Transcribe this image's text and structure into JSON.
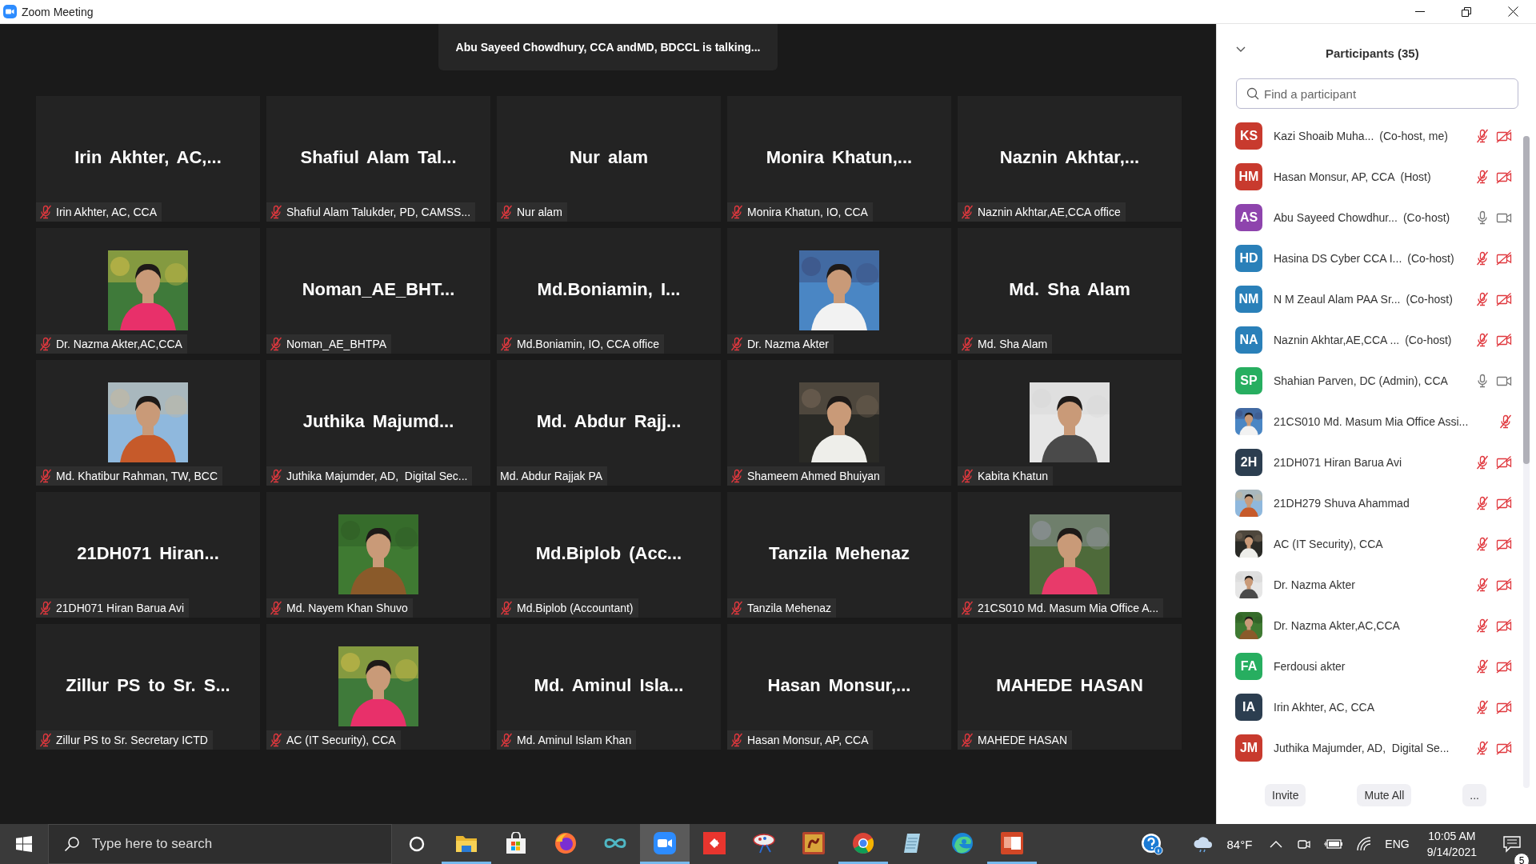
{
  "window": {
    "title": "Zoom Meeting"
  },
  "speaker_banner": "Abu Sayeed Chowdhury, CCA andMD, BDCCL is talking...",
  "tiles": [
    {
      "kind": "name",
      "display": "Irin Akhter, AC,...",
      "label": "Irin Akhter, AC, CCA",
      "muted": true
    },
    {
      "kind": "name",
      "display": "Shafiul Alam Tal...",
      "label": "Shafiul Alam Talukder, PD, CAMSS...",
      "muted": true
    },
    {
      "kind": "name",
      "display": "Nur alam",
      "label": "Nur alam",
      "muted": true
    },
    {
      "kind": "name",
      "display": "Monira Khatun,...",
      "label": "Monira Khatun, IO, CCA",
      "muted": true
    },
    {
      "kind": "name",
      "display": "Naznin Akhtar,...",
      "label": "Naznin Akhtar,AE,CCA office",
      "muted": true
    },
    {
      "label": "Dr. Nazma Akter,AC,CCA",
      "muted": true
    },
    {
      "kind": "name",
      "display": "Noman_AE_BHT...",
      "label": "Noman_AE_BHTPA",
      "muted": true
    },
    {
      "kind": "name",
      "display": "Md.Boniamin, I...",
      "label": "Md.Boniamin, IO, CCA office",
      "muted": true
    },
    {
      "label": "Dr. Nazma Akter",
      "muted": true
    },
    {
      "kind": "name",
      "display": "Md. Sha Alam",
      "label": "Md. Sha Alam",
      "muted": true
    },
    {
      "label": "Md. Khatibur Rahman, TW, BCC",
      "muted": true
    },
    {
      "kind": "name",
      "display": "Juthika Majumd...",
      "label": "Juthika Majumder, AD,  Digital Sec...",
      "muted": true
    },
    {
      "kind": "name",
      "display": "Md. Abdur Rajj...",
      "label": "Md. Abdur Rajjak PA",
      "muted": false
    },
    {
      "label": "Shameem Ahmed Bhuiyan",
      "muted": true
    },
    {
      "label": "Kabita Khatun",
      "muted": true
    },
    {
      "kind": "name",
      "display": "21DH071 Hiran...",
      "label": "21DH071 Hiran Barua Avi",
      "muted": true
    },
    {
      "label": "Md. Nayem Khan Shuvo",
      "muted": true
    },
    {
      "kind": "name",
      "display": "Md.Biplob (Acc...",
      "label": "Md.Biplob (Accountant)",
      "muted": true
    },
    {
      "kind": "name",
      "display": "Tanzila Mehenaz",
      "label": "Tanzila Mehenaz",
      "muted": true
    },
    {
      "label": "21CS010 Md. Masum Mia Office A...",
      "muted": true
    },
    {
      "kind": "name",
      "display": "Zillur PS to Sr. S...",
      "label": "Zillur PS to Sr. Secretary ICTD",
      "muted": true
    },
    {
      "label": "AC (IT Security), CCA",
      "muted": true
    },
    {
      "kind": "name",
      "display": "Md. Aminul Isla...",
      "label": "Md. Aminul Islam Khan",
      "muted": true
    },
    {
      "kind": "name",
      "display": "Hasan Monsur,...",
      "label": "Hasan Monsur, AP, CCA",
      "muted": true
    },
    {
      "kind": "name",
      "display": "MAHEDE HASAN",
      "label": "MAHEDE HASAN",
      "muted": true
    }
  ],
  "participants_panel": {
    "title": "Participants (35)",
    "search": {
      "placeholder": "Find a participant"
    },
    "participants": [
      {
        "avatar": {
          "kind": "initials",
          "text": "KS",
          "color": "#c83a2e"
        },
        "name": "Kazi Shoaib Muha...",
        "role": "(Co-host, me)",
        "muted": true,
        "video_on": false
      },
      {
        "avatar": {
          "kind": "initials",
          "text": "HM",
          "color": "#c83a2e"
        },
        "name": "Hasan Monsur, AP, CCA",
        "role": "(Host)",
        "muted": true,
        "video_on": false
      },
      {
        "avatar": {
          "kind": "initials",
          "text": "AS",
          "color": "#8e44ad"
        },
        "name": "Abu Sayeed Chowdhur...",
        "role": "(Co-host)",
        "muted": false,
        "video_on": true
      },
      {
        "avatar": {
          "kind": "initials",
          "text": "HD",
          "color": "#2a80b9"
        },
        "name": "Hasina DS Cyber CCA I...",
        "role": "(Co-host)",
        "muted": true,
        "video_on": false
      },
      {
        "avatar": {
          "kind": "initials",
          "text": "NM",
          "color": "#2a80b9"
        },
        "name": "N M Zeaul Alam PAA Sr...",
        "role": "(Co-host)",
        "muted": true,
        "video_on": false
      },
      {
        "avatar": {
          "kind": "initials",
          "text": "NA",
          "color": "#2a80b9"
        },
        "name": "Naznin Akhtar,AE,CCA ...",
        "role": "(Co-host)",
        "muted": true,
        "video_on": false
      },
      {
        "avatar": {
          "kind": "initials",
          "text": "SP",
          "color": "#27ae60"
        },
        "name": "Shahian Parven, DC (Admin), CCA",
        "muted": false,
        "video_on": true
      },
      {
        "name": "21CS010 Md. Masum Mia Office Assi...",
        "muted": true
      },
      {
        "avatar": {
          "kind": "initials",
          "text": "2H",
          "color": "#2c3e50"
        },
        "name": "21DH071 Hiran Barua Avi",
        "muted": true,
        "video_on": false
      },
      {
        "name": "21DH279 Shuva Ahammad",
        "muted": true,
        "video_on": false
      },
      {
        "name": "AC (IT Security), CCA",
        "muted": true,
        "video_on": false
      },
      {
        "name": "Dr. Nazma Akter",
        "muted": true,
        "video_on": false
      },
      {
        "name": "Dr. Nazma Akter,AC,CCA",
        "muted": true,
        "video_on": false
      },
      {
        "avatar": {
          "kind": "initials",
          "text": "FA",
          "color": "#27ae60"
        },
        "name": "Ferdousi akter",
        "muted": true,
        "video_on": false
      },
      {
        "avatar": {
          "kind": "initials",
          "text": "IA",
          "color": "#2c3e50"
        },
        "name": "Irin Akhter, AC, CCA",
        "muted": true,
        "video_on": false
      },
      {
        "avatar": {
          "kind": "initials",
          "text": "JM",
          "color": "#c83a2e"
        },
        "name": "Juthika Majumder, AD,  Digital Se...",
        "muted": true,
        "video_on": false
      }
    ],
    "buttons": [
      "Invite",
      "Mute All",
      "..."
    ]
  },
  "taskbar": {
    "search": {
      "placeholder": "Type here to search"
    },
    "apps": [
      {
        "kind": "explorer",
        "running": true,
        "selected": false
      },
      {
        "kind": "store",
        "running": false,
        "selected": false
      },
      {
        "kind": "firefox",
        "running": false,
        "selected": false
      },
      {
        "kind": "infinity",
        "running": false,
        "selected": false
      },
      {
        "kind": "zoom",
        "running": true,
        "selected": true
      },
      {
        "kind": "redapp",
        "running": false,
        "selected": false
      },
      {
        "kind": "paint",
        "running": false,
        "selected": false
      },
      {
        "kind": "bookapp",
        "running": false,
        "selected": false
      },
      {
        "kind": "chrome",
        "running": true,
        "selected": false
      },
      {
        "kind": "notepad",
        "running": false,
        "selected": false
      },
      {
        "kind": "edge",
        "running": false,
        "selected": false
      },
      {
        "kind": "powerpoint",
        "running": true,
        "selected": false
      }
    ],
    "temperature": "84°F",
    "language": "ENG",
    "time": "10:05 AM",
    "date": "9/14/2021",
    "notifications": "5"
  }
}
